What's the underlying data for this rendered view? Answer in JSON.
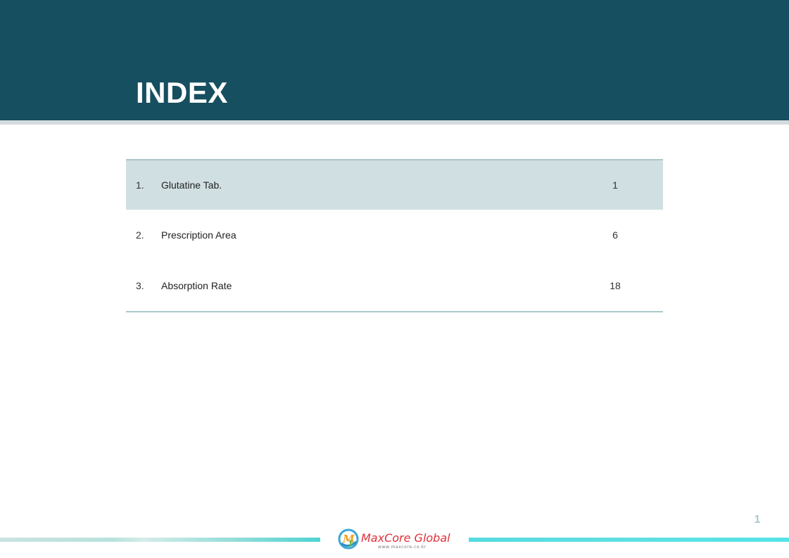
{
  "slide": {
    "title": "INDEX",
    "page_number": "1"
  },
  "index": {
    "items": [
      {
        "number": "1.",
        "label": "Glutatine Tab.",
        "page": "1"
      },
      {
        "number": "2.",
        "label": "Prescription Area",
        "page": "6"
      },
      {
        "number": "3.",
        "label": "Absorption Rate",
        "page": "18"
      }
    ]
  },
  "footer": {
    "logo_name": "MaxCore Global",
    "logo_url": "www.maxcore.co.kr"
  },
  "colors": {
    "header_bg": "#164f5f",
    "row_highlight": "#d0dfe2",
    "logo_red": "#e0303a",
    "accent_teal": "#4fd3d4"
  }
}
